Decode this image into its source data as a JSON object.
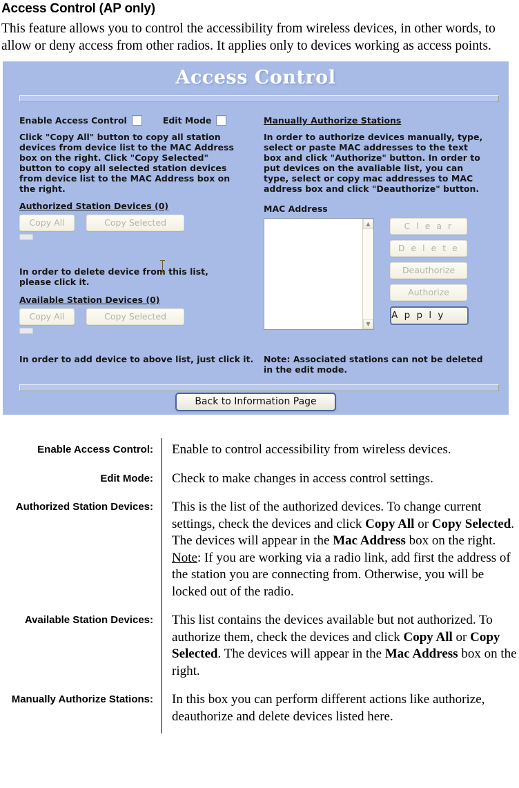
{
  "page": {
    "title": "Access Control (AP only)",
    "intro": "This feature allows you to control the accessibility from wireless devices, in other words, to allow or deny access from other radios. It applies only to devices working as access points."
  },
  "screenshot": {
    "title": "Access Control",
    "enable_access_control_label": "Enable Access Control",
    "edit_mode_label": "Edit Mode",
    "copy_help": "Click \"Copy All\" button to copy all station devices from device list to the MAC Address box on the right. Click \"Copy Selected\" button to copy all selected station devices from device list to the MAC Address box on the right.",
    "authorized_heading": "Authorized Station Devices (0)",
    "available_heading": "Available Station Devices (0)",
    "copy_all_label": "Copy All",
    "copy_selected_label": "Copy Selected",
    "delete_help": "In order to delete device from this list, please click it.",
    "add_help": "In order to add device to above list, just click it.",
    "manual_heading": "Manually Authorize Stations",
    "manual_help": "In order to authorize devices manually, type, select or paste MAC addresses to the text box and click \"Authorize\" button. In order to put devices on the avaliable list, you can type, select or copy mac addresses to MAC address box and click \"Deauthorize\" button.",
    "mac_address_label": "MAC Address",
    "mac_address_value": "",
    "clear_label": "C l e a r",
    "delete_label": "D e l e t e",
    "deauthorize_label": "Deauthorize",
    "authorize_label": "Authorize",
    "apply_label": "A p p l y",
    "note": "Note: Associated stations can not be deleted in the edit mode.",
    "back_button_label": "Back to Information Page",
    "colors": {
      "panel_bg": "#a8bbe6",
      "title_text": "#ffffff",
      "button_face": "#f7f5ea",
      "disabled_text": "#b6b2a6",
      "focus_border": "#4e639a"
    }
  },
  "definitions": [
    {
      "term": "Enable Access Control:",
      "parts": [
        {
          "t": "Enable to control accessibility from wireless devices.",
          "s": "n"
        }
      ]
    },
    {
      "term": "Edit Mode:",
      "parts": [
        {
          "t": "Check to make changes in access control settings.",
          "s": "n"
        }
      ]
    },
    {
      "term": "Authorized Station Devices:",
      "parts": [
        {
          "t": "This is the list of the authorized devices. To change current settings, check the devices and click ",
          "s": "n"
        },
        {
          "t": "Copy All",
          "s": "b"
        },
        {
          "t": " or ",
          "s": "n"
        },
        {
          "t": "Copy Selected",
          "s": "b"
        },
        {
          "t": ". The devices will appear in the ",
          "s": "n"
        },
        {
          "t": "Mac Address",
          "s": "b"
        },
        {
          "t": " box on the right.",
          "s": "n"
        },
        {
          "t": "\n",
          "s": "br"
        },
        {
          "t": "Note",
          "s": "u"
        },
        {
          "t": ": If you are working via a radio link, add first the address of the station you are connecting from. Otherwise, you will be locked out of the radio.",
          "s": "n"
        }
      ]
    },
    {
      "term": "Available Station Devices:",
      "parts": [
        {
          "t": "This list contains the devices available but not authorized. To authorize them, check the devices and click ",
          "s": "n"
        },
        {
          "t": "Copy All",
          "s": "b"
        },
        {
          "t": " or ",
          "s": "n"
        },
        {
          "t": "Copy Selected",
          "s": "b"
        },
        {
          "t": ". The devices will appear in the ",
          "s": "n"
        },
        {
          "t": "Mac Address",
          "s": "b"
        },
        {
          "t": " box on the right.",
          "s": "n"
        }
      ]
    },
    {
      "term": "Manually Authorize Stations:",
      "parts": [
        {
          "t": "In this box you can perform different actions like authorize, deauthorize and delete devices listed here.",
          "s": "n"
        }
      ]
    }
  ]
}
